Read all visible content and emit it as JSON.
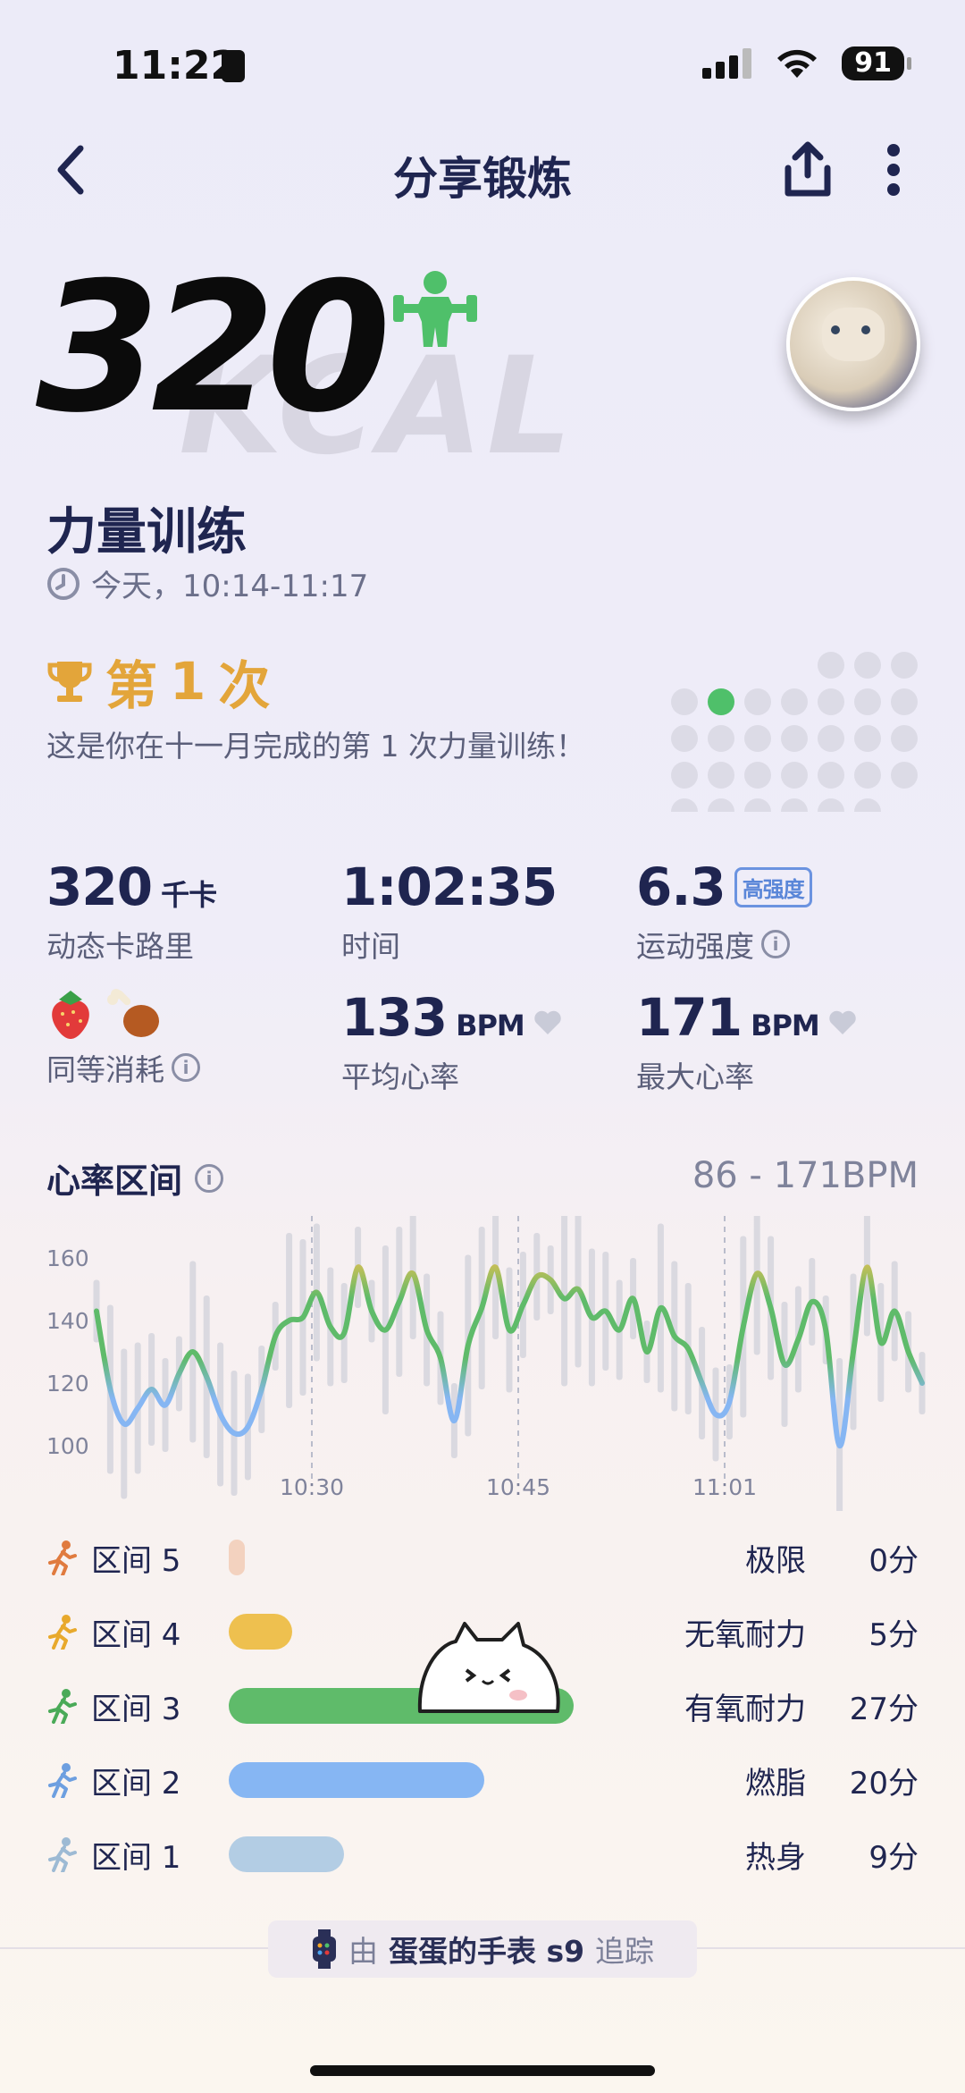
{
  "status_bar": {
    "time": "11:22",
    "battery": "91"
  },
  "nav": {
    "title": "分享锻炼"
  },
  "summary": {
    "kcal": "320",
    "kcal_bg": "KCAL",
    "workout_name": "力量训练",
    "time_range": "今天，10:14-11:17"
  },
  "achievement": {
    "prefix": "第",
    "count": "1",
    "suffix": "次",
    "subtitle": "这是你在十一月完成的第 1 次力量训练！"
  },
  "stats": {
    "calories": {
      "value": "320",
      "unit": "千卡",
      "label": "动态卡路里"
    },
    "duration": {
      "value": "1:02:35",
      "label": "时间"
    },
    "intensity": {
      "value": "6.3",
      "badge": "高强度",
      "label": "运动强度"
    },
    "equivalent": {
      "label": "同等消耗"
    },
    "avg_hr": {
      "value": "133",
      "unit": "BPM",
      "label": "平均心率"
    },
    "max_hr": {
      "value": "171",
      "unit": "BPM",
      "label": "最大心率"
    }
  },
  "heart_zone": {
    "title": "心率区间",
    "range": "86 - 171BPM",
    "zones": [
      {
        "label": "区间 5",
        "name": "极限",
        "minutes": "0分",
        "value": 0,
        "color": "#f3d2bf",
        "icon_color": "#e07b3f"
      },
      {
        "label": "区间 4",
        "name": "无氧耐力",
        "minutes": "5分",
        "value": 5,
        "color": "#eec04f",
        "icon_color": "#e8a92c"
      },
      {
        "label": "区间 3",
        "name": "有氧耐力",
        "minutes": "27分",
        "value": 27,
        "color": "#5fbb6a",
        "icon_color": "#4aaa58"
      },
      {
        "label": "区间 2",
        "name": "燃脂",
        "minutes": "20分",
        "value": 20,
        "color": "#86b6f3",
        "icon_color": "#6d9fe0"
      },
      {
        "label": "区间 1",
        "name": "热身",
        "minutes": "9分",
        "value": 9,
        "color": "#b3cde4",
        "icon_color": "#9dbad4"
      }
    ]
  },
  "chart_data": {
    "type": "line",
    "y_ticks": [
      "160",
      "140",
      "120",
      "100"
    ],
    "x_ticks": [
      "10:30",
      "10:45",
      "11:01"
    ],
    "ylim": [
      90,
      170
    ],
    "xlim": [
      0,
      60
    ],
    "x": [
      0,
      1,
      2,
      3,
      4,
      5,
      6,
      7,
      8,
      9,
      10,
      11,
      12,
      13,
      14,
      15,
      16,
      17,
      18,
      19,
      20,
      21,
      22,
      23,
      24,
      25,
      26,
      27,
      28,
      29,
      30,
      31,
      32,
      33,
      34,
      35,
      36,
      37,
      38,
      39,
      40,
      41,
      42,
      43,
      44,
      45,
      46,
      47,
      48,
      49,
      50,
      51,
      52,
      53,
      54,
      55,
      56,
      57,
      58,
      59,
      60
    ],
    "y": [
      143,
      118,
      107,
      112,
      118,
      113,
      123,
      130,
      122,
      110,
      104,
      106,
      118,
      135,
      140,
      141,
      149,
      138,
      136,
      157,
      143,
      137,
      146,
      155,
      137,
      128,
      108,
      132,
      144,
      157,
      137,
      145,
      154,
      153,
      147,
      150,
      141,
      143,
      137,
      147,
      130,
      144,
      135,
      131,
      120,
      110,
      114,
      138,
      155,
      144,
      126,
      134,
      146,
      137,
      100,
      130,
      157,
      133,
      143,
      130,
      120
    ]
  },
  "footer": {
    "prefix": "由",
    "device": "蛋蛋的手表 s9",
    "suffix": "追踪"
  }
}
